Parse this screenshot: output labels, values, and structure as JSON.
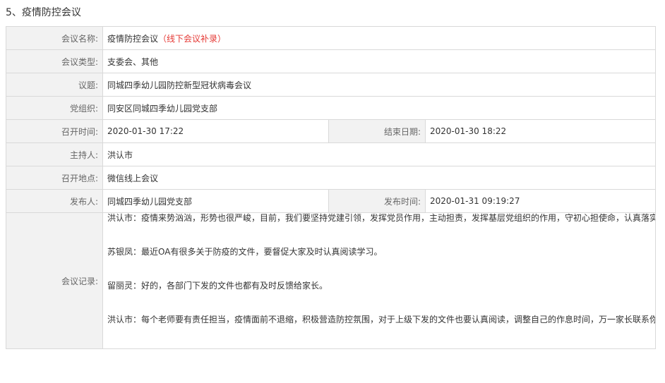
{
  "section": {
    "title": "5、疫情防控会议"
  },
  "meeting": {
    "name_label": "会议名称:",
    "name_value": "疫情防控会议",
    "name_note": "（线下会议补录）",
    "type_label": "会议类型:",
    "type_value": "支委会、其他",
    "topic_label": "议题:",
    "topic_value": "同城四季幼儿园防控新型冠状病毒会议",
    "org_label": "党组织:",
    "org_value": "同安区同城四季幼儿园党支部",
    "start_label": "召开时间:",
    "start_value": "2020-01-30 17:22",
    "end_label": "结束日期:",
    "end_value": "2020-01-30 18:22",
    "host_label": "主持人:",
    "host_value": "洪认市",
    "place_label": "召开地点:",
    "place_value": "微信线上会议",
    "publisher_label": "发布人:",
    "publisher_value": "同城四季幼儿园党支部",
    "pubtime_label": "发布时间:",
    "pubtime_value": "2020-01-31 09:19:27",
    "records_label": "会议记录:",
    "records": [
      "洪认市：疫情来势汹汹，形势也很严峻，目前，我们要坚持党建引领，发挥党员作用，主动担责，发挥基层党组织的作用，守初心担使命，认真落实确保生命，防控就是责任，不麻痹，充分利用LED，校园公众号家长微信群，广泛宣传，发动老师到，我们该做什么？发动广大家长，发动小手拉大手，营造全社会，积极营造防控意识，加大力度宣传。",
      "苏银凤：最近OA有很多关于防疫的文件，要督促大家及时认真阅读学习。",
      "留丽灵：好的，各部门下发的文件也都有及时反馈给家长。",
      "洪认市：每个老师要有责任担当，疫情面前不退缩，积极营造防控氛围，对于上级下发的文件也要认真阅读，调整自己的作息时间，万一家长联系你了呢！可不要出现还在睡觉错过了联系时间"
    ]
  }
}
